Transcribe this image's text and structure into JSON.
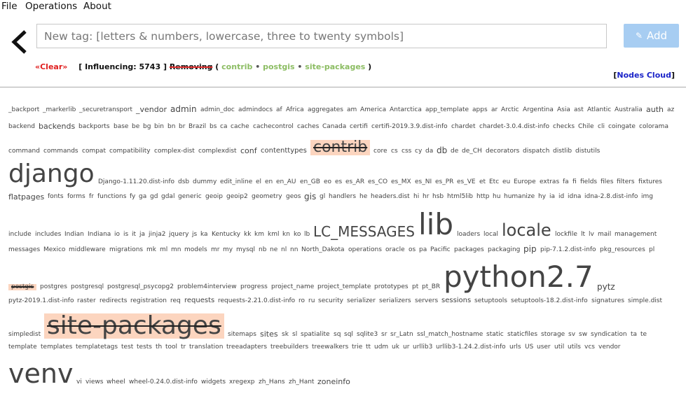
{
  "menu": {
    "file": "File",
    "operations": "Operations",
    "about": "About"
  },
  "tag_input": {
    "placeholder": "New tag: [letters & numbers, lowercase, three to twenty symbols]",
    "value": ""
  },
  "add_button": {
    "label": "Add",
    "icon": "pencil-icon"
  },
  "back_icon": "chevron-left-icon",
  "status": {
    "clear": "«Clear»",
    "influencing": "[ Influencing: 5743 ]",
    "removing": "Removing",
    "open_paren": "(",
    "close_paren": ")",
    "separator": "•",
    "tags": [
      "contrib",
      "postgis",
      "site-packages"
    ]
  },
  "nodes_cloud": {
    "open": "[",
    "label": "Nodes Cloud",
    "close": "]"
  },
  "colors": {
    "removed_bg": "#fcd5bf",
    "influence_tag": "#8cbd63",
    "clear": "#e02020",
    "link": "#1a23c8",
    "add_button": "#a7cdf2"
  },
  "cloud": [
    {
      "text": "_backport",
      "size": 9
    },
    {
      "text": "_markerlib",
      "size": 9
    },
    {
      "text": "_securetransport",
      "size": 9
    },
    {
      "text": "_vendor",
      "size": 11
    },
    {
      "text": "admin",
      "size": 12
    },
    {
      "text": "admin_doc",
      "size": 9
    },
    {
      "text": "admindocs",
      "size": 9
    },
    {
      "text": "af",
      "size": 9
    },
    {
      "text": "Africa",
      "size": 9
    },
    {
      "text": "aggregates",
      "size": 9
    },
    {
      "text": "am",
      "size": 9
    },
    {
      "text": "America",
      "size": 9
    },
    {
      "text": "Antarctica",
      "size": 9
    },
    {
      "text": "app_template",
      "size": 9
    },
    {
      "text": "apps",
      "size": 9
    },
    {
      "text": "ar",
      "size": 9
    },
    {
      "text": "Arctic",
      "size": 9
    },
    {
      "text": "Argentina",
      "size": 9
    },
    {
      "text": "Asia",
      "size": 9
    },
    {
      "text": "ast",
      "size": 9
    },
    {
      "text": "Atlantic",
      "size": 9
    },
    {
      "text": "Australia",
      "size": 9
    },
    {
      "text": "auth",
      "size": 11
    },
    {
      "text": "az",
      "size": 9
    },
    {
      "text": "backend",
      "size": 9
    },
    {
      "text": "backends",
      "size": 11
    },
    {
      "text": "backports",
      "size": 9
    },
    {
      "text": "base",
      "size": 9
    },
    {
      "text": "be",
      "size": 9
    },
    {
      "text": "bg",
      "size": 9
    },
    {
      "text": "bin",
      "size": 9
    },
    {
      "text": "bn",
      "size": 9
    },
    {
      "text": "br",
      "size": 9
    },
    {
      "text": "Brazil",
      "size": 9
    },
    {
      "text": "bs",
      "size": 9
    },
    {
      "text": "ca",
      "size": 9
    },
    {
      "text": "cache",
      "size": 9
    },
    {
      "text": "cachecontrol",
      "size": 9
    },
    {
      "text": "caches",
      "size": 9
    },
    {
      "text": "Canada",
      "size": 9
    },
    {
      "text": "certifi",
      "size": 9
    },
    {
      "text": "certifi-2019.3.9.dist-info",
      "size": 9
    },
    {
      "text": "chardet",
      "size": 9
    },
    {
      "text": "chardet-3.0.4.dist-info",
      "size": 9
    },
    {
      "text": "checks",
      "size": 9
    },
    {
      "text": "Chile",
      "size": 9
    },
    {
      "text": "cli",
      "size": 9
    },
    {
      "text": "coingate",
      "size": 9
    },
    {
      "text": "colorama",
      "size": 9
    },
    {
      "text": "command",
      "size": 9
    },
    {
      "text": "commands",
      "size": 9
    },
    {
      "text": "compat",
      "size": 9
    },
    {
      "text": "compatibility",
      "size": 9
    },
    {
      "text": "complex-dist",
      "size": 9
    },
    {
      "text": "complexdist",
      "size": 9
    },
    {
      "text": "conf",
      "size": 11
    },
    {
      "text": "contenttypes",
      "size": 10
    },
    {
      "text": "contrib",
      "size": 22,
      "removed": true
    },
    {
      "text": "core",
      "size": 9
    },
    {
      "text": "cs",
      "size": 9
    },
    {
      "text": "css",
      "size": 9
    },
    {
      "text": "cy",
      "size": 9
    },
    {
      "text": "da",
      "size": 9
    },
    {
      "text": "db",
      "size": 12
    },
    {
      "text": "de",
      "size": 9
    },
    {
      "text": "de_CH",
      "size": 9
    },
    {
      "text": "decorators",
      "size": 9
    },
    {
      "text": "dispatch",
      "size": 9
    },
    {
      "text": "distlib",
      "size": 9
    },
    {
      "text": "distutils",
      "size": 9
    },
    {
      "text": "django",
      "size": 36
    },
    {
      "text": "Django-1.11.20.dist-info",
      "size": 9
    },
    {
      "text": "dsb",
      "size": 9
    },
    {
      "text": "dummy",
      "size": 9
    },
    {
      "text": "edit_inline",
      "size": 9
    },
    {
      "text": "el",
      "size": 9
    },
    {
      "text": "en",
      "size": 9
    },
    {
      "text": "en_AU",
      "size": 9
    },
    {
      "text": "en_GB",
      "size": 9
    },
    {
      "text": "eo",
      "size": 9
    },
    {
      "text": "es",
      "size": 9
    },
    {
      "text": "es_AR",
      "size": 9
    },
    {
      "text": "es_CO",
      "size": 9
    },
    {
      "text": "es_MX",
      "size": 9
    },
    {
      "text": "es_NI",
      "size": 9
    },
    {
      "text": "es_PR",
      "size": 9
    },
    {
      "text": "es_VE",
      "size": 9
    },
    {
      "text": "et",
      "size": 9
    },
    {
      "text": "Etc",
      "size": 9
    },
    {
      "text": "eu",
      "size": 9
    },
    {
      "text": "Europe",
      "size": 9
    },
    {
      "text": "extras",
      "size": 9
    },
    {
      "text": "fa",
      "size": 9
    },
    {
      "text": "fi",
      "size": 9
    },
    {
      "text": "fields",
      "size": 9
    },
    {
      "text": "files",
      "size": 9
    },
    {
      "text": "filters",
      "size": 9
    },
    {
      "text": "fixtures",
      "size": 9
    },
    {
      "text": "flatpages",
      "size": 11
    },
    {
      "text": "fonts",
      "size": 9
    },
    {
      "text": "forms",
      "size": 9
    },
    {
      "text": "fr",
      "size": 9
    },
    {
      "text": "functions",
      "size": 9
    },
    {
      "text": "fy",
      "size": 9
    },
    {
      "text": "ga",
      "size": 9
    },
    {
      "text": "gd",
      "size": 9
    },
    {
      "text": "gdal",
      "size": 9
    },
    {
      "text": "generic",
      "size": 9
    },
    {
      "text": "geoip",
      "size": 9
    },
    {
      "text": "geoip2",
      "size": 9
    },
    {
      "text": "geometry",
      "size": 9
    },
    {
      "text": "geos",
      "size": 9
    },
    {
      "text": "gis",
      "size": 12
    },
    {
      "text": "gl",
      "size": 9
    },
    {
      "text": "handlers",
      "size": 9
    },
    {
      "text": "he",
      "size": 9
    },
    {
      "text": "headers.dist",
      "size": 9
    },
    {
      "text": "hi",
      "size": 9
    },
    {
      "text": "hr",
      "size": 9
    },
    {
      "text": "hsb",
      "size": 9
    },
    {
      "text": "html5lib",
      "size": 9
    },
    {
      "text": "http",
      "size": 9
    },
    {
      "text": "hu",
      "size": 9
    },
    {
      "text": "humanize",
      "size": 9
    },
    {
      "text": "hy",
      "size": 9
    },
    {
      "text": "ia",
      "size": 9
    },
    {
      "text": "id",
      "size": 9
    },
    {
      "text": "idna",
      "size": 9
    },
    {
      "text": "idna-2.8.dist-info",
      "size": 9
    },
    {
      "text": "img",
      "size": 9
    },
    {
      "text": "include",
      "size": 9
    },
    {
      "text": "includes",
      "size": 9
    },
    {
      "text": "Indian",
      "size": 9
    },
    {
      "text": "Indiana",
      "size": 9
    },
    {
      "text": "io",
      "size": 9
    },
    {
      "text": "is",
      "size": 9
    },
    {
      "text": "it",
      "size": 9
    },
    {
      "text": "ja",
      "size": 9
    },
    {
      "text": "jinja2",
      "size": 9
    },
    {
      "text": "jquery",
      "size": 9
    },
    {
      "text": "js",
      "size": 9
    },
    {
      "text": "ka",
      "size": 9
    },
    {
      "text": "Kentucky",
      "size": 9
    },
    {
      "text": "kk",
      "size": 9
    },
    {
      "text": "km",
      "size": 9
    },
    {
      "text": "kml",
      "size": 9
    },
    {
      "text": "kn",
      "size": 9
    },
    {
      "text": "ko",
      "size": 9
    },
    {
      "text": "lb",
      "size": 9
    },
    {
      "text": "LC_MESSAGES",
      "size": 20
    },
    {
      "text": "lib",
      "size": 42
    },
    {
      "text": "loaders",
      "size": 9
    },
    {
      "text": "local",
      "size": 9
    },
    {
      "text": "locale",
      "size": 24
    },
    {
      "text": "lockfile",
      "size": 9
    },
    {
      "text": "lt",
      "size": 9
    },
    {
      "text": "lv",
      "size": 9
    },
    {
      "text": "mail",
      "size": 9
    },
    {
      "text": "management",
      "size": 9
    },
    {
      "text": "messages",
      "size": 9
    },
    {
      "text": "Mexico",
      "size": 9
    },
    {
      "text": "middleware",
      "size": 9
    },
    {
      "text": "migrations",
      "size": 9
    },
    {
      "text": "mk",
      "size": 9
    },
    {
      "text": "ml",
      "size": 9
    },
    {
      "text": "mn",
      "size": 9
    },
    {
      "text": "models",
      "size": 9
    },
    {
      "text": "mr",
      "size": 9
    },
    {
      "text": "my",
      "size": 9
    },
    {
      "text": "mysql",
      "size": 9
    },
    {
      "text": "nb",
      "size": 9
    },
    {
      "text": "ne",
      "size": 9
    },
    {
      "text": "nl",
      "size": 9
    },
    {
      "text": "nn",
      "size": 9
    },
    {
      "text": "North_Dakota",
      "size": 9
    },
    {
      "text": "operations",
      "size": 9
    },
    {
      "text": "oracle",
      "size": 9
    },
    {
      "text": "os",
      "size": 9
    },
    {
      "text": "pa",
      "size": 9
    },
    {
      "text": "Pacific",
      "size": 9
    },
    {
      "text": "packages",
      "size": 9
    },
    {
      "text": "packaging",
      "size": 9
    },
    {
      "text": "pip",
      "size": 12
    },
    {
      "text": "pip-7.1.2.dist-info",
      "size": 9
    },
    {
      "text": "pkg_resources",
      "size": 9
    },
    {
      "text": "pl",
      "size": 9
    },
    {
      "text": "postgis",
      "size": 9,
      "removed": true
    },
    {
      "text": "postgres",
      "size": 9
    },
    {
      "text": "postgresql",
      "size": 9
    },
    {
      "text": "postgresql_psycopg2",
      "size": 9
    },
    {
      "text": "problem4interview",
      "size": 9
    },
    {
      "text": "progress",
      "size": 9
    },
    {
      "text": "project_name",
      "size": 9
    },
    {
      "text": "project_template",
      "size": 9
    },
    {
      "text": "prototypes",
      "size": 9
    },
    {
      "text": "pt",
      "size": 9
    },
    {
      "text": "pt_BR",
      "size": 9
    },
    {
      "text": "python2.7",
      "size": 42
    },
    {
      "text": "pytz",
      "size": 12
    },
    {
      "text": "pytz-2019.1.dist-info",
      "size": 9
    },
    {
      "text": "raster",
      "size": 9
    },
    {
      "text": "redirects",
      "size": 9
    },
    {
      "text": "registration",
      "size": 9
    },
    {
      "text": "req",
      "size": 9
    },
    {
      "text": "requests",
      "size": 10
    },
    {
      "text": "requests-2.21.0.dist-info",
      "size": 9
    },
    {
      "text": "ro",
      "size": 9
    },
    {
      "text": "ru",
      "size": 9
    },
    {
      "text": "security",
      "size": 9
    },
    {
      "text": "serializer",
      "size": 9
    },
    {
      "text": "serializers",
      "size": 9
    },
    {
      "text": "servers",
      "size": 9
    },
    {
      "text": "sessions",
      "size": 10
    },
    {
      "text": "setuptools",
      "size": 9
    },
    {
      "text": "setuptools-18.2.dist-info",
      "size": 9
    },
    {
      "text": "signatures",
      "size": 9
    },
    {
      "text": "simple.dist",
      "size": 9
    },
    {
      "text": "simpledist",
      "size": 9
    },
    {
      "text": "site-packages",
      "size": 36,
      "removed": true
    },
    {
      "text": "sitemaps",
      "size": 9
    },
    {
      "text": "sites",
      "size": 11
    },
    {
      "text": "sk",
      "size": 9
    },
    {
      "text": "sl",
      "size": 9
    },
    {
      "text": "spatialite",
      "size": 9
    },
    {
      "text": "sq",
      "size": 9
    },
    {
      "text": "sql",
      "size": 9
    },
    {
      "text": "sqlite3",
      "size": 9
    },
    {
      "text": "sr",
      "size": 9
    },
    {
      "text": "sr_Latn",
      "size": 9
    },
    {
      "text": "ssl_match_hostname",
      "size": 9
    },
    {
      "text": "static",
      "size": 9
    },
    {
      "text": "staticfiles",
      "size": 9
    },
    {
      "text": "storage",
      "size": 9
    },
    {
      "text": "sv",
      "size": 9
    },
    {
      "text": "sw",
      "size": 9
    },
    {
      "text": "syndication",
      "size": 9
    },
    {
      "text": "ta",
      "size": 9
    },
    {
      "text": "te",
      "size": 9
    },
    {
      "text": "template",
      "size": 9
    },
    {
      "text": "templates",
      "size": 9
    },
    {
      "text": "templatetags",
      "size": 9
    },
    {
      "text": "test",
      "size": 9
    },
    {
      "text": "tests",
      "size": 9
    },
    {
      "text": "th",
      "size": 9
    },
    {
      "text": "tool",
      "size": 9
    },
    {
      "text": "tr",
      "size": 9
    },
    {
      "text": "translation",
      "size": 9
    },
    {
      "text": "treeadapters",
      "size": 9
    },
    {
      "text": "treebuilders",
      "size": 9
    },
    {
      "text": "treewalkers",
      "size": 9
    },
    {
      "text": "trie",
      "size": 9
    },
    {
      "text": "tt",
      "size": 9
    },
    {
      "text": "udm",
      "size": 9
    },
    {
      "text": "uk",
      "size": 9
    },
    {
      "text": "ur",
      "size": 9
    },
    {
      "text": "urllib3",
      "size": 9
    },
    {
      "text": "urllib3-1.24.2.dist-info",
      "size": 9
    },
    {
      "text": "urls",
      "size": 9
    },
    {
      "text": "US",
      "size": 9
    },
    {
      "text": "user",
      "size": 9
    },
    {
      "text": "util",
      "size": 9
    },
    {
      "text": "utils",
      "size": 9
    },
    {
      "text": "vcs",
      "size": 9
    },
    {
      "text": "vendor",
      "size": 9
    },
    {
      "text": "venv",
      "size": 38
    },
    {
      "text": "vi",
      "size": 9
    },
    {
      "text": "views",
      "size": 9
    },
    {
      "text": "wheel",
      "size": 9
    },
    {
      "text": "wheel-0.24.0.dist-info",
      "size": 9
    },
    {
      "text": "widgets",
      "size": 9
    },
    {
      "text": "xregexp",
      "size": 9
    },
    {
      "text": "zh_Hans",
      "size": 9
    },
    {
      "text": "zh_Hant",
      "size": 9
    },
    {
      "text": "zoneinfo",
      "size": 11
    }
  ]
}
